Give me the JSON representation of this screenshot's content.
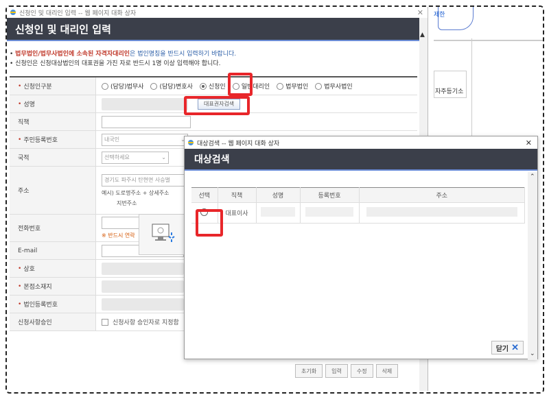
{
  "background": {
    "link_text": "제한",
    "cell_text": "자주등기소"
  },
  "main_dialog": {
    "window_title": "신청인 및 대리인 입력 -- 웹 페이지 대화 상자",
    "header": "신청인 및 대리인 입력",
    "notice1_red": "법무법인/법무사법인에 소속된 자격자대리인",
    "notice1_blue": "은 법인명칭을 반드시 입력하기 바랍니다.",
    "notice2": "신청인은 신청대상법인의 대표권을 가진 자로 반드시 1명 이상 입력해야 합니다.",
    "rows": {
      "applicant_type": "신청인구분",
      "name": "성명",
      "position": "직책",
      "resident_number": "주민등록번호",
      "nationality": "국적",
      "address": "주소",
      "phone": "전화번호",
      "email": "E-mail",
      "trade_name": "상호",
      "head_office": "본점소재지",
      "corp_number": "법인등록번호",
      "approval": "신청사항승인"
    },
    "radio_options": [
      "(담당)법무사",
      "(담당)변호사",
      "신청인",
      "일반대리인",
      "법무법인",
      "법무사법인"
    ],
    "selected_radio": "신청인",
    "rep_search_button": "대표권자검색",
    "resident_select": "내국인",
    "nationality_select": "선택하세요",
    "address_placeholder": "경기도 파주시 탄현면 사승벌",
    "address_example": "예시) 도로명주소 + 상세주소",
    "address_lot": "지번주소",
    "phone_note": "※ 반드시 연락",
    "approval_text": "신청사항 승인자로 지정함",
    "buttons": [
      "초기화",
      "입력",
      "수정",
      "삭제"
    ]
  },
  "search_dialog": {
    "window_title": "대상검색 -- 웹 페이지 대화 상자",
    "header": "대상검색",
    "columns": [
      "선택",
      "직책",
      "성명",
      "등록번호",
      "주소"
    ],
    "rows": [
      {
        "position": "대표이사",
        "name": "",
        "reg_no": "",
        "address": ""
      }
    ],
    "close_label": "닫기"
  }
}
